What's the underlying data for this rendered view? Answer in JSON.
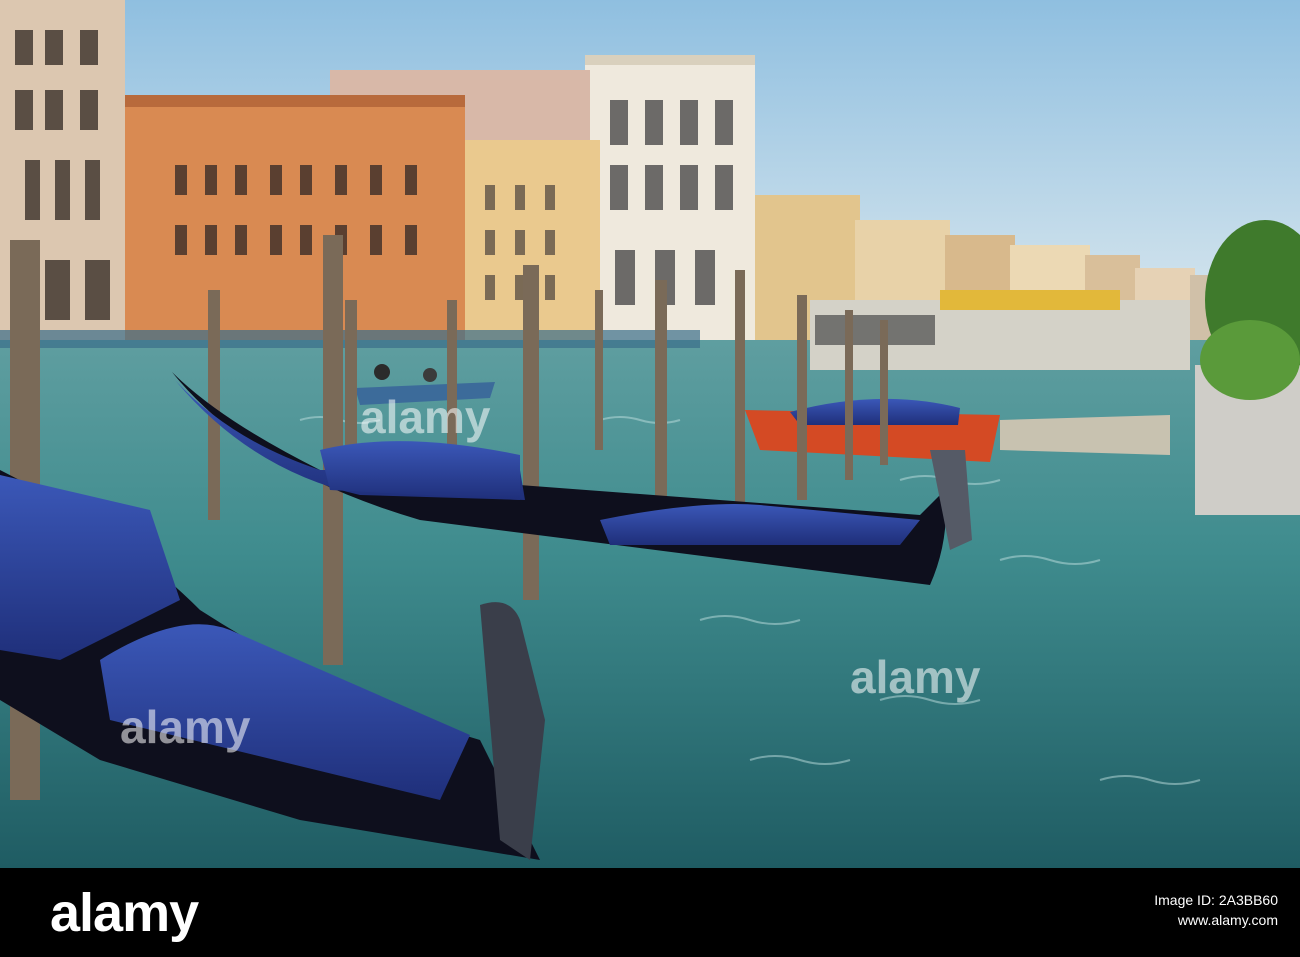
{
  "photo": {
    "scene": "venice-grand-canal-gondolas",
    "colors": {
      "sky": "#a9cbe3",
      "water": "#3e8c8c",
      "gondola_cover": "#2a3d8c",
      "gondola_hull": "#0d0f1c"
    }
  },
  "footer": {
    "brand": "alamy",
    "image_id_label": "Image ID: 2A3BB60",
    "url": "www.alamy.com"
  },
  "watermarks": [
    "alamy",
    "alamy",
    "alamy"
  ]
}
